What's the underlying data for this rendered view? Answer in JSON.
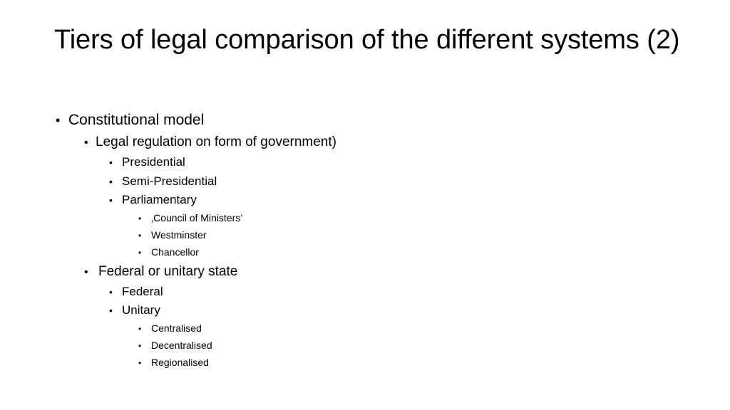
{
  "slide": {
    "title": "Tiers of legal comparison of the different systems (2)",
    "bullet_glyph": "•",
    "text_color": "#000000",
    "background_color": "#ffffff",
    "outline": [
      {
        "level": 1,
        "text": "Constitutional model"
      },
      {
        "level": 2,
        "text": "Legal regulation on form of government)"
      },
      {
        "level": 3,
        "text": "Presidential"
      },
      {
        "level": 3,
        "text": "Semi-Presidential"
      },
      {
        "level": 3,
        "text": "Parliamentary"
      },
      {
        "level": 4,
        "text": "‚Council of Ministers’"
      },
      {
        "level": 4,
        "text": "Westminster"
      },
      {
        "level": 4,
        "text": "Chancellor"
      },
      {
        "level": 2,
        "text": "Federal or unitary state",
        "wide_gap": true
      },
      {
        "level": 3,
        "text": "Federal"
      },
      {
        "level": 3,
        "text": "Unitary"
      },
      {
        "level": 4,
        "text": "Centralised"
      },
      {
        "level": 4,
        "text": "Decentralised"
      },
      {
        "level": 4,
        "text": "Regionalised"
      }
    ]
  }
}
